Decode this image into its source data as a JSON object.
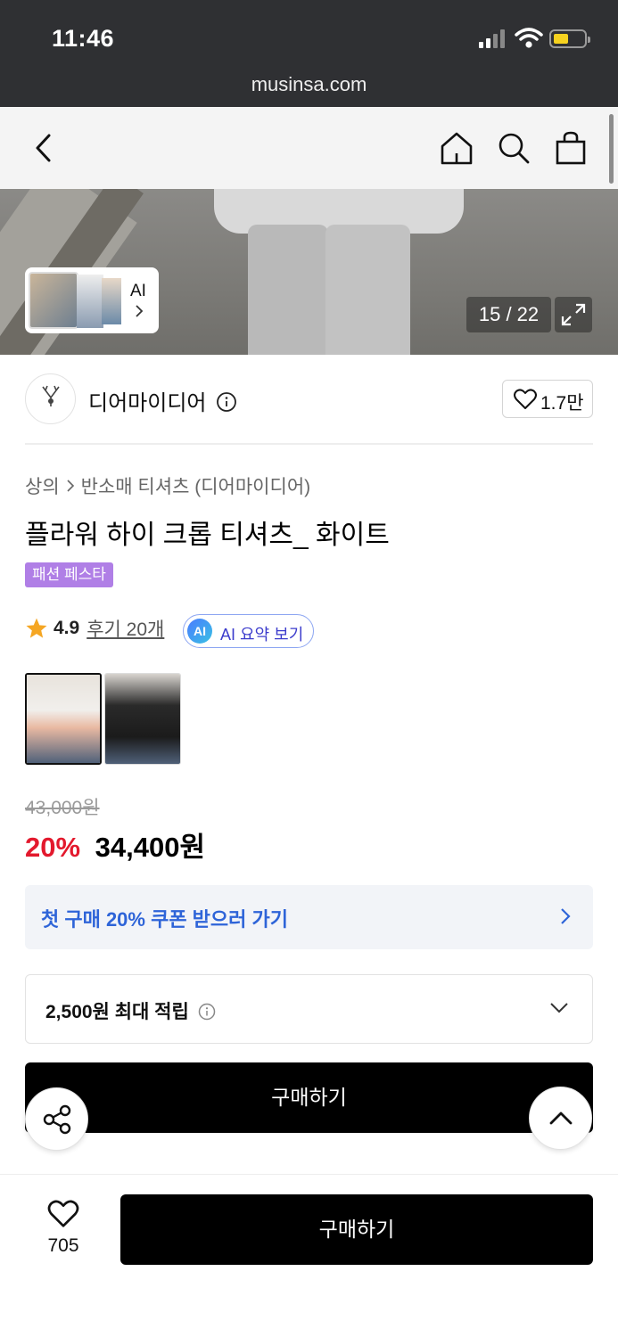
{
  "status": {
    "time": "11:46",
    "url": "musinsa.com"
  },
  "hero": {
    "ai_label": "AI",
    "counter": "15 / 22"
  },
  "brand": {
    "name": "디어마이디어",
    "likes": "1.7만"
  },
  "product": {
    "breadcrumb": {
      "category": "상의",
      "subcategory": "반소매 티셔츠 (디어마이디어)"
    },
    "title": "플라워 하이 크롭 티셔츠_ 화이트",
    "badge": "패션 페스타",
    "rating": "4.9",
    "reviews": "후기 20개",
    "ai_summary": "AI 요약 보기",
    "ai_badge": "AI",
    "original_price": "43,000원",
    "discount": "20%",
    "sale_price": "34,400원",
    "coupon_text": "첫 구매 20% 쿠폰 받으러 가기",
    "points_text": "2,500원 최대 적립",
    "buy_label": "구매하기"
  },
  "bottom": {
    "like_count": "705",
    "buy_label": "구매하기"
  },
  "colors": {
    "discount_red": "#e3192d",
    "coupon_blue": "#2e64d8",
    "badge_purple": "#b07fe6",
    "star": "#f5a623"
  }
}
